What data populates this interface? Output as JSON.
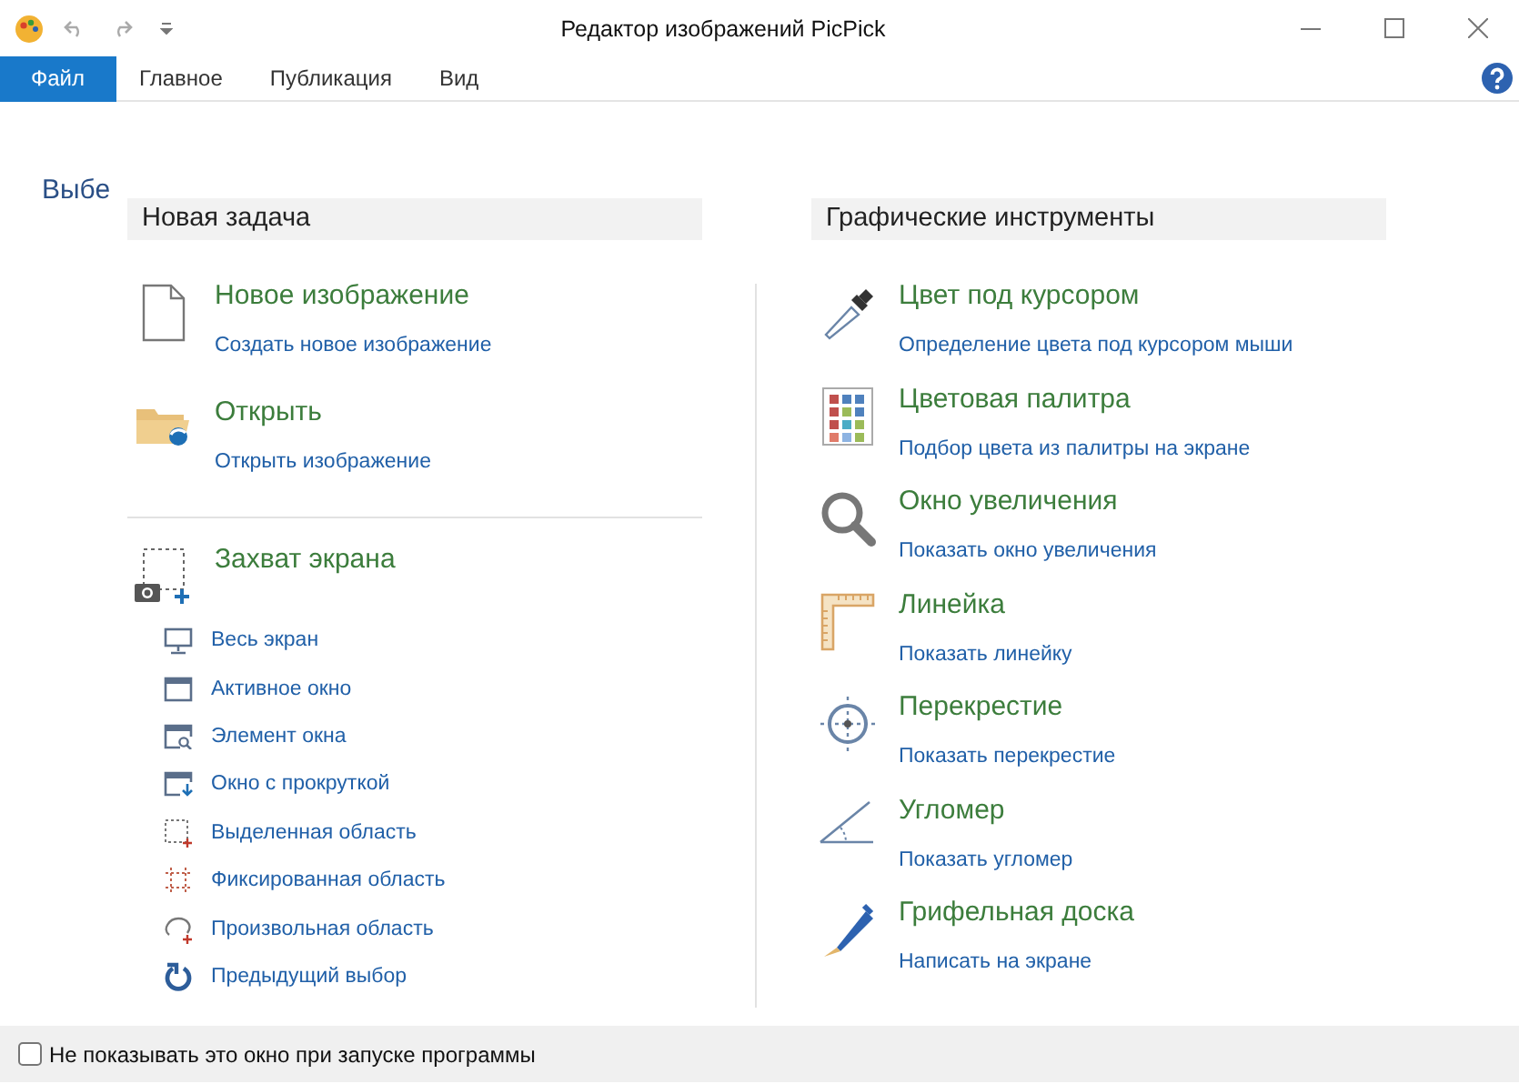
{
  "window": {
    "title": "Редактор изображений PicPick"
  },
  "ribbon_tabs": [
    {
      "label": "Файл",
      "selected": true
    },
    {
      "label": "Главное",
      "selected": false
    },
    {
      "label": "Публикация",
      "selected": false
    },
    {
      "label": "Вид",
      "selected": false
    }
  ],
  "background_text": "Выбе",
  "new_task": {
    "header": "Новая задача",
    "items": [
      {
        "title": "Новое изображение",
        "subtitle": "Создать новое изображение"
      },
      {
        "title": "Открыть",
        "subtitle": "Открыть изображение"
      }
    ],
    "capture": {
      "title": "Захват экрана",
      "options": [
        "Весь экран",
        "Активное окно",
        "Элемент окна",
        "Окно с прокруткой",
        "Выделенная область",
        "Фиксированная область",
        "Произвольная область",
        "Предыдущий выбор"
      ]
    }
  },
  "graphic_tools": {
    "header": "Графические инструменты",
    "items": [
      {
        "title": "Цвет под курсором",
        "subtitle": "Определение цвета под курсором мыши"
      },
      {
        "title": "Цветовая палитра",
        "subtitle": "Подбор цвета из палитры на экране"
      },
      {
        "title": "Окно увеличения",
        "subtitle": "Показать окно увеличения"
      },
      {
        "title": "Линейка",
        "subtitle": "Показать линейку"
      },
      {
        "title": "Перекрестие",
        "subtitle": "Показать перекрестие"
      },
      {
        "title": "Угломер",
        "subtitle": "Показать угломер"
      },
      {
        "title": "Грифельная доска",
        "subtitle": "Написать на экране"
      }
    ]
  },
  "footer": {
    "label": "Не показывать это окно при запуске программы",
    "checked": false
  }
}
